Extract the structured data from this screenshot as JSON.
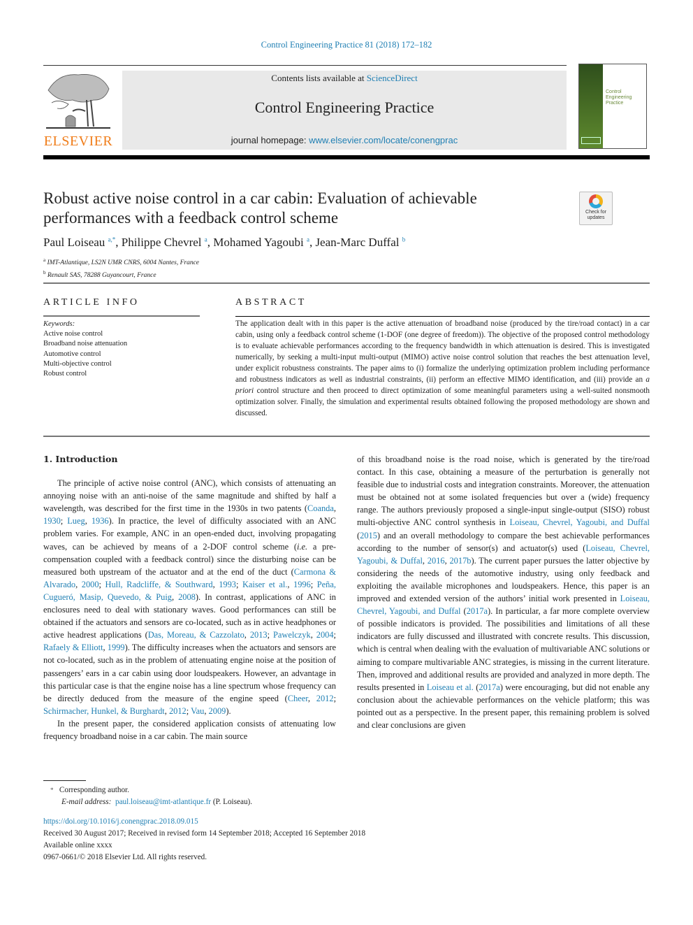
{
  "journal_ref": "Control Engineering Practice 81 (2018) 172–182",
  "masthead": {
    "contents_prefix": "Contents lists available at ",
    "contents_link": "ScienceDirect",
    "journal_title": "Control Engineering Practice",
    "homepage_prefix": "journal homepage: ",
    "homepage_link": "www.elsevier.com/locate/conengprac",
    "publisher": "ELSEVIER",
    "cover_title": "Control Engineering Practice"
  },
  "crossmark": {
    "label": "Check for updates"
  },
  "article": {
    "title": "Robust active noise control in a car cabin: Evaluation of achievable performances with a feedback control scheme",
    "authors": [
      {
        "name": "Paul Loiseau",
        "sup": "a,*",
        "sep": ", "
      },
      {
        "name": "Philippe Chevrel",
        "sup": "a",
        "sep": ", "
      },
      {
        "name": "Mohamed Yagoubi",
        "sup": "a",
        "sep": ", "
      },
      {
        "name": "Jean-Marc Duffal",
        "sup": "b",
        "sep": ""
      }
    ],
    "affiliations": [
      {
        "sup": "a",
        "text": "IMT-Atlantique, LS2N UMR CNRS, 6004  Nantes, France"
      },
      {
        "sup": "b",
        "text": "Renault SAS, 78288  Guyancourt, France"
      }
    ]
  },
  "article_info": {
    "heading": "ARTICLE INFO",
    "keywords_label": "Keywords:",
    "keywords": [
      "Active noise control",
      "Broadband noise attenuation",
      "Automotive control",
      "Multi-objective control",
      "Robust control"
    ]
  },
  "abstract": {
    "heading": "ABSTRACT",
    "text_1": "The application dealt with in this paper is the active attenuation of broadband noise (produced by the tire/road contact) in a car cabin, using only a feedback control scheme (1-DOF (one degree of freedom)). The objective of the proposed control methodology is to evaluate achievable performances according to the frequency bandwidth in which attenuation is desired. This is investigated numerically, by seeking a multi-input multi-output (MIMO) active noise control solution that reaches the best attenuation level, under explicit robustness constraints. The paper aims to (i) formalize the underlying optimization problem including performance and robustness indicators as well as industrial constraints, (ii) perform an effective MIMO identification, and (iii) provide an ",
    "text_italic": "a priori",
    "text_2": " control structure and then proceed to direct optimization of some meaningful parameters using a well-suited nonsmooth optimization solver. Finally, the simulation and experimental results obtained following the proposed methodology are shown and discussed."
  },
  "intro": {
    "heading": "1.  Introduction",
    "left_p1": [
      {
        "t": "The principle of active noise control (ANC), which consists of attenuating an annoying noise with an anti-noise of the same magnitude and shifted by half a wavelength, was described for the first time in the 1930s in two patents ("
      },
      {
        "l": "Coanda"
      },
      {
        "t": ", "
      },
      {
        "l": "1930"
      },
      {
        "t": "; "
      },
      {
        "l": "Lueg"
      },
      {
        "t": ", "
      },
      {
        "l": "1936"
      },
      {
        "t": "). In practice, the level of difficulty associated with an ANC problem varies. For example, ANC in an open-ended duct, involving propagating waves, can be achieved by means of a 2-DOF control scheme ("
      },
      {
        "i": "i.e."
      },
      {
        "t": " a pre-compensation coupled with a feedback control) since the disturbing noise can be measured both upstream of the actuator and at the end of the duct ("
      },
      {
        "l": "Carmona & Alvarado"
      },
      {
        "t": ", "
      },
      {
        "l": "2000"
      },
      {
        "t": "; "
      },
      {
        "l": "Hull, Radcliffe, & Southward"
      },
      {
        "t": ", "
      },
      {
        "l": "1993"
      },
      {
        "t": "; "
      },
      {
        "l": "Kaiser et al."
      },
      {
        "t": ", "
      },
      {
        "l": "1996"
      },
      {
        "t": "; "
      },
      {
        "l": "Peña, Cugueró, Masip, Quevedo, & Puig"
      },
      {
        "t": ", "
      },
      {
        "l": "2008"
      },
      {
        "t": "). In contrast, applications of ANC in enclosures need to deal with stationary waves. Good performances can still be obtained if the actuators and sensors are co-located, such as in active headphones or active headrest applications ("
      },
      {
        "l": "Das, Moreau, & Cazzolato"
      },
      {
        "t": ", "
      },
      {
        "l": "2013"
      },
      {
        "t": "; "
      },
      {
        "l": "Pawelczyk"
      },
      {
        "t": ", "
      },
      {
        "l": "2004"
      },
      {
        "t": "; "
      },
      {
        "l": "Rafaely & Elliott"
      },
      {
        "t": ", "
      },
      {
        "l": "1999"
      },
      {
        "t": "). The difficulty increases when the actuators and sensors are not co-located, such as in the problem of attenuating engine noise at the position of passengers’ ears in a car cabin using door loudspeakers. However, an advantage in this particular case is that the engine noise has a line spectrum whose frequency can be directly deduced from the measure of the engine speed ("
      },
      {
        "l": "Cheer"
      },
      {
        "t": ", "
      },
      {
        "l": "2012"
      },
      {
        "t": "; "
      },
      {
        "l": "Schirmacher, Hunkel, & Burghardt"
      },
      {
        "t": ", "
      },
      {
        "l": "2012"
      },
      {
        "t": "; "
      },
      {
        "l": "Vau"
      },
      {
        "t": ", "
      },
      {
        "l": "2009"
      },
      {
        "t": ")."
      }
    ],
    "left_p2": "In the present paper, the considered application consists of attenuating low frequency broadband noise in a car cabin. The main source",
    "right_p1": [
      {
        "t": "of this broadband noise is the road noise, which is generated by the tire/road contact. In this case, obtaining a measure of the perturbation is generally not feasible due to industrial costs and integration constraints. Moreover, the attenuation must be obtained not at some isolated frequencies but over a (wide) frequency range. The authors previously proposed a single-input single-output (SISO) robust multi-objective ANC control synthesis in "
      },
      {
        "l": "Loiseau, Chevrel, Yagoubi, and Duffal"
      },
      {
        "t": " ("
      },
      {
        "l": "2015"
      },
      {
        "t": ") and an overall methodology to compare the best achievable performances according to the number of sensor(s) and actuator(s) used ("
      },
      {
        "l": "Loiseau, Chevrel, Yagoubi, & Duffal"
      },
      {
        "t": ", "
      },
      {
        "l": "2016"
      },
      {
        "t": ", "
      },
      {
        "l": "2017b"
      },
      {
        "t": "). The current paper pursues the latter objective by considering the needs of the automotive industry, using only feedback and exploiting the available microphones and loudspeakers. Hence, this paper is an improved and extended version of the authors’ initial work presented in "
      },
      {
        "l": "Loiseau, Chevrel, Yagoubi, and Duffal"
      },
      {
        "t": " ("
      },
      {
        "l": "2017a"
      },
      {
        "t": "). In particular, a far more complete overview of possible indicators is provided. The possibilities and limitations of all these indicators are fully discussed and illustrated with concrete results. This discussion, which is central when dealing with the evaluation of multivariable ANC solutions or aiming to compare multivariable ANC strategies, is missing in the current literature. Then, improved and additional results are provided and analyzed in more depth. The results presented in "
      },
      {
        "l": "Loiseau et al."
      },
      {
        "t": " ("
      },
      {
        "l": "2017a"
      },
      {
        "t": ") were encouraging, but did not enable any conclusion about the achievable performances on the vehicle platform; this was pointed out as a perspective. In the present paper, this remaining problem is solved and clear conclusions are given"
      }
    ]
  },
  "footnotes": {
    "star": "*",
    "corresponding": "Corresponding author.",
    "email_label": "E-mail address:",
    "email": "paul.loiseau@imt-atlantique.fr",
    "email_suffix": " (P. Loiseau)."
  },
  "pubinfo": {
    "doi": "https://doi.org/10.1016/j.conengprac.2018.09.015",
    "history": "Received 30 August 2017; Received in revised form 14 September 2018; Accepted 16 September 2018",
    "available": "Available online  xxxx",
    "copyright": "0967-0661/© 2018 Elsevier Ltd. All rights reserved."
  }
}
